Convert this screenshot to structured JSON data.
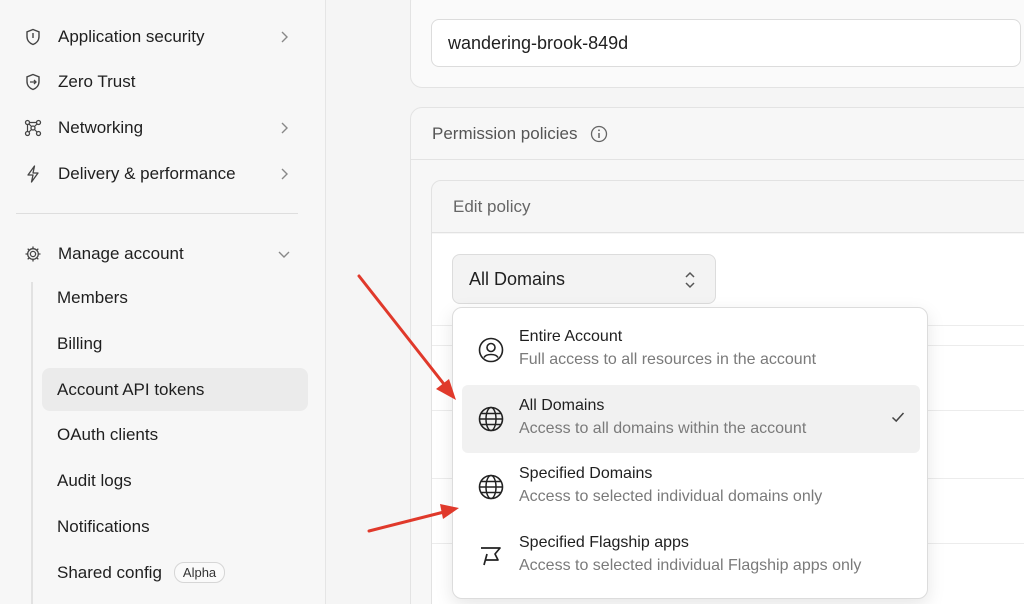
{
  "sidebar": {
    "items": [
      {
        "label": "Application security",
        "icon": "shield-icon",
        "has_chevron": true
      },
      {
        "label": "Zero Trust",
        "icon": "zero-trust-icon",
        "has_chevron": false
      },
      {
        "label": "Networking",
        "icon": "network-icon",
        "has_chevron": true
      },
      {
        "label": "Delivery & performance",
        "icon": "bolt-icon",
        "has_chevron": true
      }
    ],
    "manage_account": {
      "label": "Manage account",
      "icon": "gear-icon",
      "expanded": true,
      "subitems": [
        {
          "label": "Members"
        },
        {
          "label": "Billing"
        },
        {
          "label": "Account API tokens",
          "active": true
        },
        {
          "label": "OAuth clients"
        },
        {
          "label": "Audit logs"
        },
        {
          "label": "Notifications"
        },
        {
          "label": "Shared config",
          "badge": "Alpha"
        }
      ]
    }
  },
  "main": {
    "token_name_value": "wandering-brook-849d",
    "permission_policies_label": "Permission policies",
    "edit_policy_label": "Edit policy",
    "scope_select": {
      "selected": "All Domains",
      "options": [
        {
          "title": "Entire Account",
          "description": "Full access to all resources in the account",
          "icon": "user-circle-icon",
          "selected": false
        },
        {
          "title": "All Domains",
          "description": "Access to all domains within the account",
          "icon": "globe-icon",
          "selected": true
        },
        {
          "title": "Specified Domains",
          "description": "Access to selected individual domains only",
          "icon": "globe-icon",
          "selected": false
        },
        {
          "title": "Specified Flagship apps",
          "description": "Access to selected individual Flagship apps only",
          "icon": "flag-icon",
          "selected": false
        }
      ]
    }
  },
  "colors": {
    "annotation_arrow": "#e0392b",
    "active_bg": "#ebebeb",
    "selected_option_bg": "#f1f1f1"
  }
}
